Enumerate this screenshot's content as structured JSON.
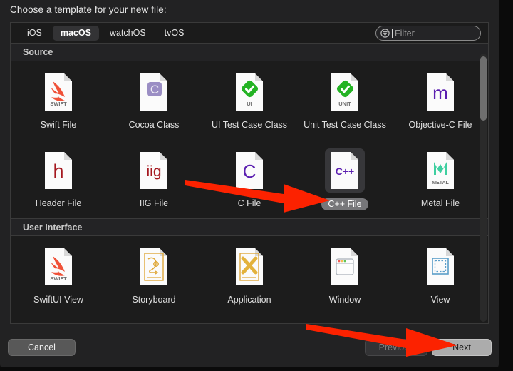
{
  "dialog": {
    "prompt": "Choose a template for your new file:"
  },
  "tabs": [
    {
      "label": "iOS",
      "selected": false
    },
    {
      "label": "macOS",
      "selected": true
    },
    {
      "label": "watchOS",
      "selected": false
    },
    {
      "label": "tvOS",
      "selected": false
    }
  ],
  "filter": {
    "value": "",
    "placeholder": "Filter",
    "icon": "filter-icon"
  },
  "sections": [
    {
      "title": "Source",
      "rows": [
        [
          {
            "label": "Swift File",
            "icon": "swift-file-icon",
            "selected": false
          },
          {
            "label": "Cocoa Class",
            "icon": "cocoa-class-icon",
            "selected": false
          },
          {
            "label": "UI Test Case Class",
            "icon": "ui-test-case-icon",
            "selected": false
          },
          {
            "label": "Unit Test Case Class",
            "icon": "unit-test-case-icon",
            "selected": false
          },
          {
            "label": "Objective-C File",
            "icon": "objective-c-file-icon",
            "selected": false
          }
        ],
        [
          {
            "label": "Header File",
            "icon": "header-file-icon",
            "selected": false
          },
          {
            "label": "IIG File",
            "icon": "iig-file-icon",
            "selected": false
          },
          {
            "label": "C File",
            "icon": "c-file-icon",
            "selected": false
          },
          {
            "label": "C++ File",
            "icon": "cpp-file-icon",
            "selected": true
          },
          {
            "label": "Metal File",
            "icon": "metal-file-icon",
            "selected": false
          }
        ]
      ]
    },
    {
      "title": "User Interface",
      "rows": [
        [
          {
            "label": "SwiftUI View",
            "icon": "swiftui-view-icon",
            "selected": false
          },
          {
            "label": "Storyboard",
            "icon": "storyboard-icon",
            "selected": false
          },
          {
            "label": "Application",
            "icon": "application-icon",
            "selected": false
          },
          {
            "label": "Window",
            "icon": "window-icon",
            "selected": false
          },
          {
            "label": "View",
            "icon": "view-icon",
            "selected": false
          }
        ]
      ]
    }
  ],
  "footer": {
    "cancel_label": "Cancel",
    "previous_label": "Previous",
    "previous_disabled": true,
    "next_label": "Next"
  },
  "annotations": [
    {
      "name": "arrow-pointing-to-cpp-file",
      "color": "#FC2200"
    },
    {
      "name": "arrow-pointing-to-next-button",
      "color": "#FC2200"
    }
  ],
  "scrollbar": {
    "position": "top"
  },
  "colors": {
    "dialog_background": "#222223",
    "panel_background": "#1c1c1c",
    "selection": "#37373a",
    "selection_label": "#77777a",
    "annotation_red": "#FC2200"
  }
}
